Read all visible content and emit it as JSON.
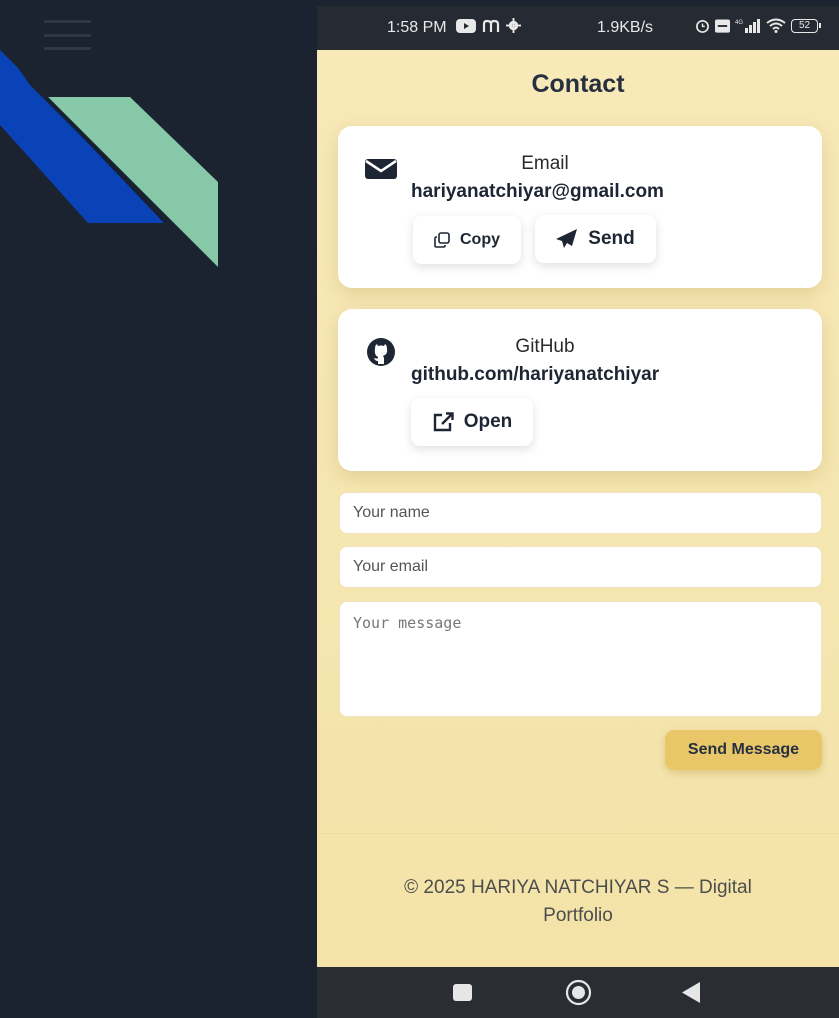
{
  "left_panel": {
    "menu_icon": "hamburger-menu-icon",
    "decor_colors": [
      "#0a43b8",
      "#86c8a8"
    ]
  },
  "status_bar": {
    "time": "1:58 PM",
    "left_icons": [
      "youtube-icon",
      "m-icon",
      "settings-icon"
    ],
    "network_rate": "1.9KB/s",
    "right_icons": [
      "alarm-icon",
      "volte-icon",
      "4g-signal-icon",
      "wifi-icon"
    ],
    "battery": "52"
  },
  "page": {
    "title": "Contact"
  },
  "contact_cards": {
    "email": {
      "icon": "envelope-icon",
      "label": "Email",
      "value": "hariyanatchiyar@gmail.com",
      "copy_label": "Copy",
      "send_label": "Send"
    },
    "github": {
      "icon": "github-icon",
      "label": "GitHub",
      "value": "github.com/hariyanatchiyar",
      "open_label": "Open"
    }
  },
  "form": {
    "name_placeholder": "Your name",
    "email_placeholder": "Your email",
    "message_placeholder": "Your message",
    "submit_label": "Send Message"
  },
  "footer": {
    "text": "© 2025 HARIYA NATCHIYAR S — Digital Portfolio"
  },
  "nav_bar": {
    "buttons": [
      "recent-apps-icon",
      "home-icon",
      "back-icon"
    ]
  },
  "colors": {
    "page_bg": "#1b2230",
    "content_bg": "#f7e7b7",
    "accent": "#e9c768",
    "text_dark": "#26303f"
  }
}
